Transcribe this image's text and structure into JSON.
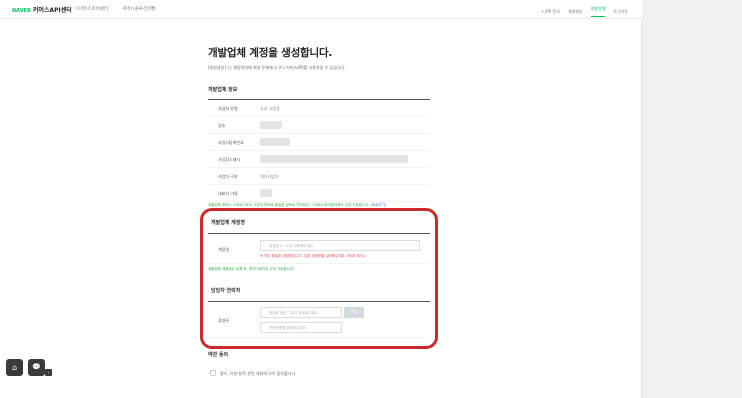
{
  "header": {
    "brand": "NAVER",
    "title": "커머스API센터",
    "nav": [
      "스마트스토어센터",
      "커머스솔루션마켓"
    ],
    "right_nav": [
      "• API 문서",
      "개발센터",
      "개발업체",
      "로그아웃"
    ]
  },
  "page": {
    "title": "개발업체 계정을 생성합니다.",
    "description": "[회원생성] 시, 계정관리에 최대 문제해 누구나 커머스API를 사용하실 수 있습니다."
  },
  "company_info": {
    "heading": "개발업체 정보",
    "rows": [
      {
        "label": "사업자 유형",
        "value": "국내 사업자"
      },
      {
        "label": "상호",
        "value": ""
      },
      {
        "label": "사업자등록번호",
        "value": ""
      },
      {
        "label": "사업장소재지",
        "value": ""
      },
      {
        "label": "사업자 구분",
        "value": "개인사업자"
      },
      {
        "label": "대표자 이름",
        "value": ""
      }
    ],
    "notice": "개발업체 정보는 스마트스토어 사업자 정보와 동일한 정보로 관리되니, 스마트스토어센터에서 수정 가능합니다.",
    "notice_link": "(바로가기)"
  },
  "account": {
    "heading": "개발업체 계정명",
    "label": "계정명",
    "placeholder": "계정명 4~30자 입력해주세요",
    "error": "※ 이미 등록된 계정명입니다. 다른 계정명을 입력해주세요. (최대 30자)",
    "note": "개발업체 계정명은 등록 후, 최대 2회까지 수정 가능합니다."
  },
  "contact": {
    "heading": "담당자 연락처",
    "label": "휴대폰",
    "phone_placeholder": "휴대폰 번호 '-'없이 입력해주세요",
    "auth_button": "인증",
    "code_placeholder": "인증번호를 입력해주세요"
  },
  "terms": {
    "heading": "약관 동의",
    "agree_all": "필수, 기본 항목 관련 내용에 모두 동의합니다."
  },
  "floating": {
    "home_icon": "⌂",
    "chat_icon": "💬",
    "collapse_icon": "‹"
  },
  "colors": {
    "brand_green": "#03c75a",
    "highlight_red": "#cc2a2a",
    "error_red": "#e03c3c"
  }
}
